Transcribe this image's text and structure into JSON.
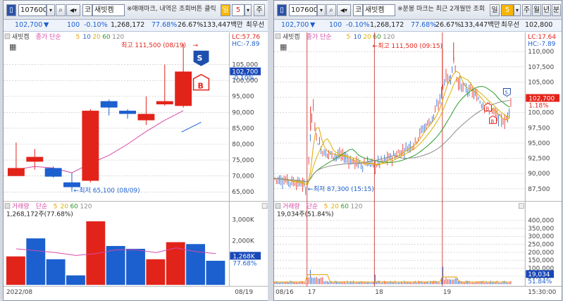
{
  "left": {
    "code": "107600",
    "market": "코",
    "name": "새빗켐",
    "marquee": "※매매마크, 내역은 조회버튼 클릭",
    "period_label": "일",
    "period_value": "5",
    "extra_btn": "주",
    "quote": {
      "price": "102,700",
      "direction": "▼",
      "change": "100",
      "rate": "-0.10%",
      "volume": "1,268,172",
      "ratio": "77.68%",
      "turnover": "26.67%",
      "amount": "133,447백만",
      "best": "최우선"
    },
    "legend": {
      "name": "새빗켐",
      "type": "종가 단순",
      "ma": [
        "5",
        "10",
        "20",
        "60",
        "120"
      ]
    },
    "lc": "LC:57.76",
    "hc": "HC:-7.89",
    "high_ann": "최고 111,500 (08/19)",
    "low_ann": "최저 65,100 (08/09)",
    "price_axis": [
      "105,000",
      "100,000",
      "95,000",
      "90,000",
      "85,000",
      "80,000",
      "75,000",
      "70,000",
      "65,000"
    ],
    "price_tag": "102,700",
    "price_tag_pct": "-0.10%",
    "signal_sell": "S",
    "signal_buy": "B",
    "vol_legend": {
      "name": "거래량",
      "type": "단순",
      "ma": [
        "5",
        "20",
        "60",
        "120"
      ]
    },
    "vol_text": "1,268,172주(77.68%)",
    "vol_axis": [
      "3,000K",
      "2,000K"
    ],
    "vol_tag": "1,268K",
    "vol_tag_pct": "77.68%",
    "x_start": "2022/08",
    "x_end": "08/19",
    "candles": [
      {
        "o": 70,
        "c": 72.5,
        "h": 80.5,
        "l": 70
      },
      {
        "o": 74.5,
        "c": 76,
        "h": 78.5,
        "l": 72
      },
      {
        "o": 72.5,
        "c": 69.8,
        "h": 73,
        "l": 69.5
      },
      {
        "o": 68,
        "c": 66.5,
        "h": 71,
        "l": 65.1
      },
      {
        "o": 68.5,
        "c": 90.5,
        "h": 91,
        "l": 68
      },
      {
        "o": 93.5,
        "c": 91.5,
        "h": 94,
        "l": 89
      },
      {
        "o": 90.5,
        "c": 89.5,
        "h": 91,
        "l": 88
      },
      {
        "o": 87.5,
        "c": 89.5,
        "h": 95,
        "l": 86
      },
      {
        "o": 92.5,
        "c": 93.5,
        "h": 105,
        "l": 92
      },
      {
        "o": 92,
        "c": 102.8,
        "h": 111.5,
        "l": 91.5
      }
    ],
    "ma5": [
      72,
      73,
      72.5,
      71,
      74,
      76.5,
      80,
      84,
      87.5,
      90.5
    ],
    "volumes": [
      1.5,
      2.45,
      1.35,
      0.5,
      3.35,
      2.05,
      1.9,
      1.35,
      2.25,
      2.15,
      1.27
    ],
    "vol_ma": [
      1.9,
      1.8,
      1.7,
      1.55,
      1.65,
      1.85,
      1.85,
      1.7,
      1.95,
      1.75,
      1.65
    ]
  },
  "right": {
    "code": "107600",
    "market": "코",
    "name": "새빗켐",
    "marquee": "※분봉 마크는 최근 2개월만 조회",
    "period_label": "일",
    "period_value": "5",
    "period_btns": [
      "주",
      "월",
      "년",
      "분"
    ],
    "quote": {
      "price": "102,700",
      "direction": "▼",
      "change": "100",
      "rate": "-0.10%",
      "volume": "1,268,172",
      "ratio": "77.68%",
      "turnover": "26.67%",
      "amount": "133,447백만",
      "best": "최우선",
      "best_price": "102,800",
      "ask": "102,700"
    },
    "legend": {
      "name": "새빗켐",
      "type": "종가 단순",
      "ma": [
        "5",
        "10",
        "20",
        "60",
        "120"
      ]
    },
    "lc": "LC:17.64",
    "hc": "HC:-7.89",
    "high_ann": "최고 111,500 (09:15)",
    "low_ann": "최저 87,300 (15:15)",
    "price_axis": [
      "110,000",
      "107,500",
      "105,000",
      "102,500",
      "100,000",
      "97,500",
      "95,000",
      "92,500",
      "90,000",
      "87,500"
    ],
    "price_tag": "102,700",
    "price_tag_pct": "1.18%",
    "signal_sell": "S",
    "signal_buy": "B",
    "vol_legend": {
      "name": "거래량",
      "type": "단순",
      "ma": [
        "5",
        "20",
        "60",
        "120"
      ]
    },
    "vol_text": "19,034주(51.84%)",
    "vol_axis": [
      "400,000",
      "350,000",
      "300,000",
      "250,000",
      "200,000",
      "150,000",
      "100,000",
      "50,000"
    ],
    "vol_tag": "19,034",
    "vol_tag_pct": "51.84%",
    "x_labels": [
      "08/16",
      "17",
      "18",
      "19"
    ],
    "x_end": "15:30:00"
  },
  "colors": {
    "up": "#e2231a",
    "down": "#1c5fcf",
    "ma5": "#e8a100",
    "ma10": "#2b67c9",
    "ma20": "#d8b400",
    "ma60": "#2f9a2f",
    "ma120": "#8a8a8a",
    "ma_pink": "#d54ba7",
    "tag": "#1747b8"
  }
}
